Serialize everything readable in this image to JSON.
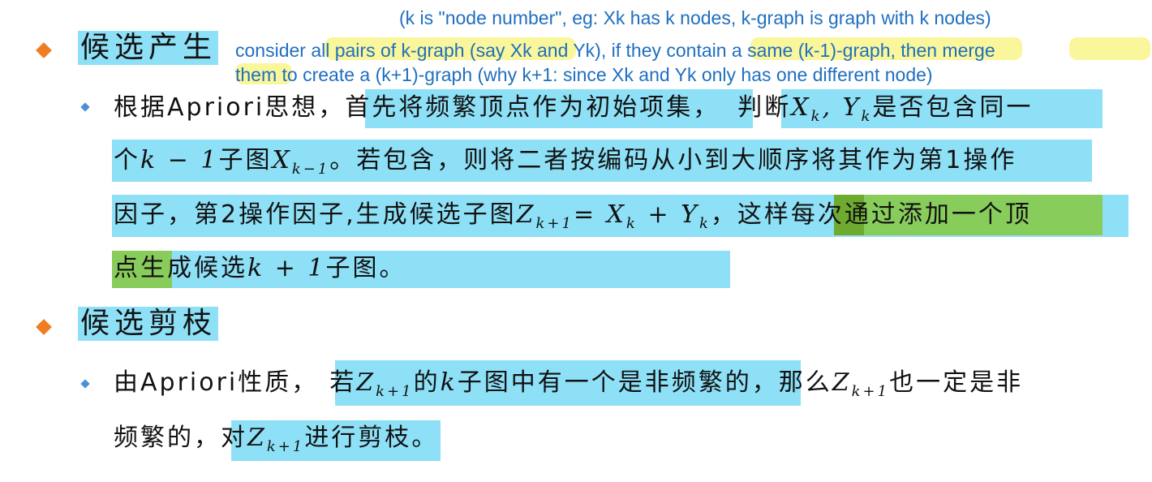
{
  "annotations": {
    "top": "(k is \"node number\", eg: Xk has k nodes, k-graph is graph with k nodes)",
    "line1": "consider all pairs of k-graph (say Xk and Yk), if they contain a same (k-1)-graph, then merge",
    "line2": "them to create a (k+1)-graph (why k+1: since Xk and Yk only has one different  node)"
  },
  "section1": {
    "heading": "候选产生",
    "para": {
      "l1_a": "根据Apriori思想，",
      "l1_b": "首先将频繁顶点作为初始项集，",
      "l1_c": "判断",
      "l1_m": "X",
      "l1_ms": "k",
      "l1_sep": ", ",
      "l1_m2": "Y",
      "l1_m2s": "k",
      "l1_d": "是否包含同一",
      "l2_a": "个",
      "l2_m": "k − 1",
      "l2_b": "子图",
      "l2_m2": "X",
      "l2_m2s": "k−1",
      "l2_c": "。若包含，则将二者按编码从小到大顺序将其作为第1操作",
      "l3_a": "因子，第2操作因子,生成候选子图",
      "l3_m": "Z",
      "l3_ms": "k+1",
      "l3_eq": "= ",
      "l3_m2": "X",
      "l3_m2s": "k",
      "l3_plus": " + ",
      "l3_m3": "Y",
      "l3_m3s": "k",
      "l3_b": "，这样",
      "l3_c": "每次通过添加一个顶",
      "l4_a": "点生",
      "l4_b": "成候选",
      "l4_m": "k + 1",
      "l4_c": "子图。"
    }
  },
  "section2": {
    "heading": "候选剪枝",
    "para": {
      "l1_a": "由Apriori性质，",
      "l1_b": "若",
      "l1_m": "Z",
      "l1_ms": "k+1",
      "l1_c": "的",
      "l1_m2": "k",
      "l1_d": "子图中有一个是非频繁的",
      "l1_e": "，那么",
      "l1_m3": "Z",
      "l1_m3s": "k+1",
      "l1_f": "也一定是非",
      "l2_a": "频繁的，",
      "l2_b": "对",
      "l2_m": "Z",
      "l2_ms": "k+1",
      "l2_c": "进行剪枝",
      "l2_d": "。"
    }
  },
  "colors": {
    "highlight_blue": "#8ee0f7",
    "highlight_green": "#88cc5c",
    "highlight_yellow": "#f8f58a",
    "annotation_text": "#1f6fbf",
    "bullet_orange": "#ef7d22",
    "bullet_blue": "#4a90d9"
  }
}
